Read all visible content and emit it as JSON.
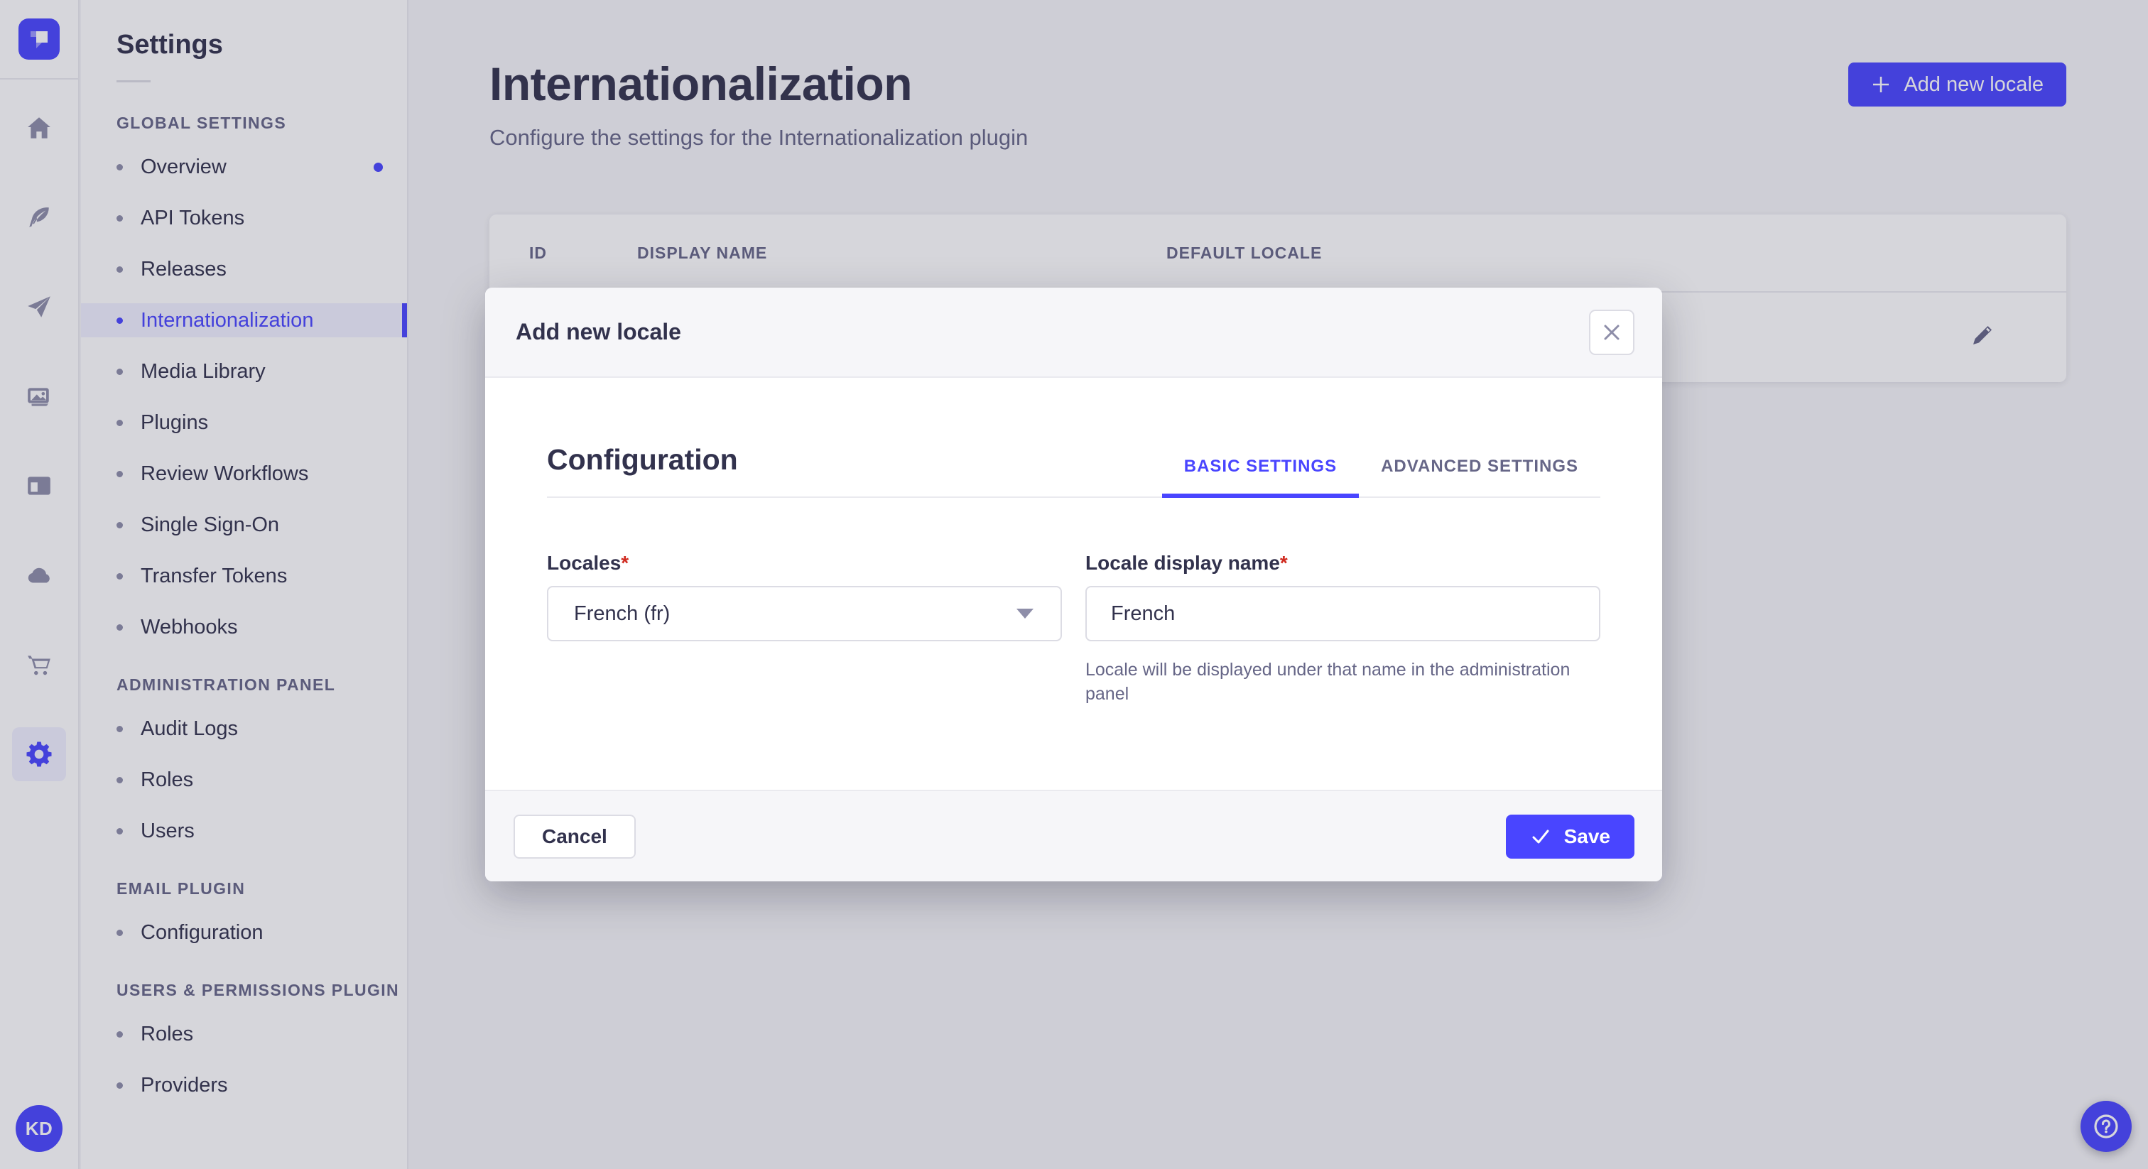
{
  "rail": {
    "logo": "strapi-logo",
    "icons": [
      "home-icon",
      "feather-icon",
      "paper-plane-icon",
      "media-library-icon",
      "content-manager-icon",
      "cloud-icon",
      "marketplace-cart-icon",
      "settings-gear-icon"
    ],
    "active_icon": "settings-gear-icon",
    "avatar": "KD"
  },
  "sidebar": {
    "title": "Settings",
    "active_item": "Internationalization",
    "sections": [
      {
        "label": "GLOBAL SETTINGS",
        "items": [
          {
            "label": "Overview",
            "notification": true
          },
          {
            "label": "API Tokens"
          },
          {
            "label": "Releases"
          },
          {
            "label": "Internationalization",
            "active": true
          },
          {
            "label": "Media Library"
          },
          {
            "label": "Plugins"
          },
          {
            "label": "Review Workflows"
          },
          {
            "label": "Single Sign-On"
          },
          {
            "label": "Transfer Tokens"
          },
          {
            "label": "Webhooks"
          }
        ]
      },
      {
        "label": "ADMINISTRATION PANEL",
        "items": [
          {
            "label": "Audit Logs"
          },
          {
            "label": "Roles"
          },
          {
            "label": "Users"
          }
        ]
      },
      {
        "label": "EMAIL PLUGIN",
        "items": [
          {
            "label": "Configuration"
          }
        ]
      },
      {
        "label": "USERS & PERMISSIONS PLUGIN",
        "items": [
          {
            "label": "Roles"
          },
          {
            "label": "Providers"
          }
        ]
      }
    ]
  },
  "header": {
    "title": "Internationalization",
    "subtitle": "Configure the settings for the Internationalization plugin",
    "add_button": "Add new locale"
  },
  "table": {
    "columns": [
      "ID",
      "DISPLAY NAME",
      "DEFAULT LOCALE"
    ]
  },
  "modal": {
    "title": "Add new locale",
    "section_title": "Configuration",
    "tabs": [
      {
        "label": "BASIC SETTINGS",
        "active": true
      },
      {
        "label": "ADVANCED SETTINGS",
        "active": false
      }
    ],
    "fields": {
      "locales": {
        "label": "Locales",
        "required": true,
        "value": "French (fr)"
      },
      "display_name": {
        "label": "Locale display name",
        "required": true,
        "value": "French",
        "help": "Locale will be displayed under that name in the administration panel"
      }
    },
    "cancel_label": "Cancel",
    "save_label": "Save"
  },
  "required_marker": "*",
  "colors": {
    "primary": "#4945ff",
    "primary_light": "#f0f0ff",
    "text": "#32324d",
    "muted": "#666687",
    "icon_gray": "#8e8ea9",
    "border": "#dcdce4",
    "divider": "#eaeaef",
    "page_bg": "#f6f6f9",
    "danger": "#d02b20",
    "overlay": "rgba(50,50,77,0.2)"
  }
}
